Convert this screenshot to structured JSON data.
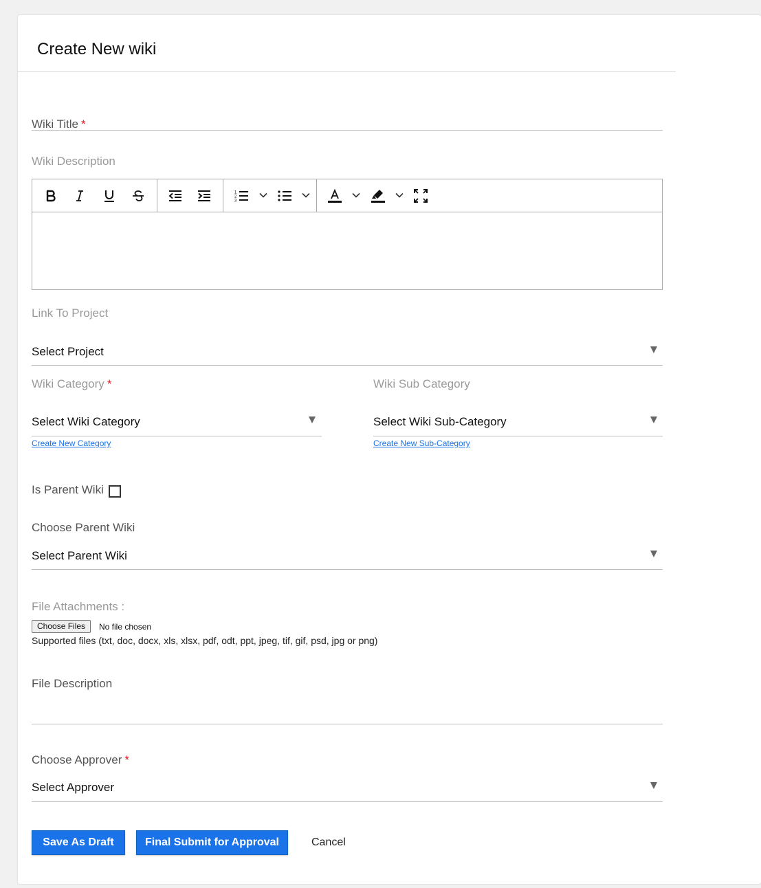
{
  "page": {
    "title": "Create New wiki"
  },
  "colors": {
    "primary": "#1a73e8",
    "required": "#e0141e",
    "link": "#1a73e8"
  },
  "form": {
    "wiki_title": {
      "label": "Wiki Title",
      "required_mark": "*"
    },
    "wiki_description": {
      "label": "Wiki Description",
      "toolbar": [
        "bold-icon",
        "italic-icon",
        "underline-icon",
        "strikethrough-icon",
        "outdent-icon",
        "indent-icon",
        "ordered-list-icon",
        "unordered-list-icon",
        "font-color-icon",
        "highlight-color-icon",
        "fullscreen-icon"
      ]
    },
    "link_to_project": {
      "label": "Link To Project",
      "selected": "Select Project"
    },
    "wiki_category": {
      "label": "Wiki Category",
      "required_mark": "*",
      "selected": "Select Wiki Category",
      "create_link": "Create New Category"
    },
    "wiki_sub_category": {
      "label": "Wiki Sub Category",
      "selected": "Select Wiki Sub-Category",
      "create_link": "Create New Sub-Category"
    },
    "is_parent_wiki": {
      "label": "Is Parent Wiki",
      "checked": false
    },
    "choose_parent_wiki": {
      "label": "Choose Parent Wiki",
      "selected": "Select Parent Wiki"
    },
    "file_attachments": {
      "label": "File Attachments :",
      "button": "Choose Files",
      "status": "No file chosen",
      "supported": "Supported files (txt, doc, docx, xls, xlsx, pdf, odt, ppt, jpeg, tif, gif, psd, jpg or png)"
    },
    "file_description": {
      "label": "File Description"
    },
    "choose_approver": {
      "label": "Choose Approver",
      "required_mark": "*",
      "selected": "Select Approver"
    }
  },
  "actions": {
    "save_draft": "Save As Draft",
    "final_submit": "Final Submit for Approval",
    "cancel": "Cancel"
  }
}
